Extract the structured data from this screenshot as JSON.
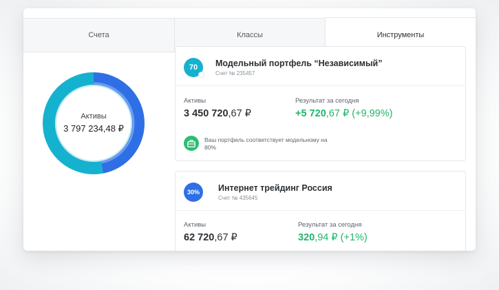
{
  "tabs": [
    {
      "label": "Счета",
      "active": false
    },
    {
      "label": "Классы",
      "active": false
    },
    {
      "label": "Инструменты",
      "active": true
    }
  ],
  "donut": {
    "caption": "Активы",
    "total": "3 797 234,48 ₽",
    "shares": [
      0.47,
      0.53
    ],
    "colors": [
      "#2f6fe6",
      "#15b2cf"
    ]
  },
  "portfolios": [
    {
      "badge": "70",
      "badge_color": "#15b2cf",
      "name": "Модельный портфель “Независимый”",
      "account": "Счет № 235457",
      "assets_label": "Активы",
      "assets_int": "3 450 720",
      "assets_dec": ",67 ₽",
      "result_label": "Результат за сегодня",
      "result_int": "+5 720",
      "result_dec": ",67 ₽ (+9,99%)",
      "note": "Ваш портфель соответствует модельному на 80%",
      "note_icon": "briefcase-icon"
    },
    {
      "badge": "30%",
      "badge_color": "#2f6fe6",
      "name": "Интернет трейдинг Россия",
      "account": "Счет № 435645",
      "assets_label": "Активы",
      "assets_int": "62 720",
      "assets_dec": ",67 ₽",
      "result_label": "Результат за сегодня",
      "result_int": "320",
      "result_dec": ",94 ₽ (+1%)"
    }
  ]
}
